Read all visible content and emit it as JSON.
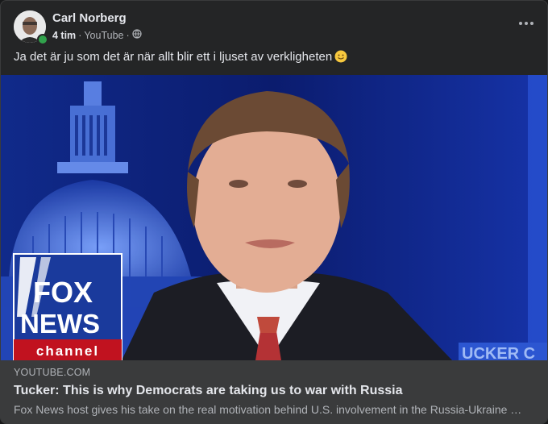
{
  "post": {
    "author": "Carl Norberg",
    "time": "4 tim",
    "source": "YouTube",
    "separator": "·",
    "text": "Ja det är ju som det är när allt blir ett i ljuset av verkligheten",
    "audience_icon": "globe-icon",
    "emoji": "slightly-smiling-face"
  },
  "video": {
    "logo_line1": "FOX",
    "logo_line2": "NEWS",
    "logo_line3": "channel",
    "lower_third_text": "UCKER C",
    "colors": {
      "background": "#0c1a6b",
      "logo_blue": "#1a3a9c",
      "logo_red": "#c1121f"
    }
  },
  "link": {
    "domain": "YOUTUBE.COM",
    "title": "Tucker: This is why Democrats are taking us to war with Russia",
    "description": "Fox News host gives his take on the real motivation behind U.S. involvement in the Russia-Ukraine war."
  },
  "colors": {
    "card": "#242526",
    "preview": "#3a3b3c",
    "text": "#e4e6eb",
    "muted": "#b0b3b8",
    "online": "#31a24c"
  }
}
